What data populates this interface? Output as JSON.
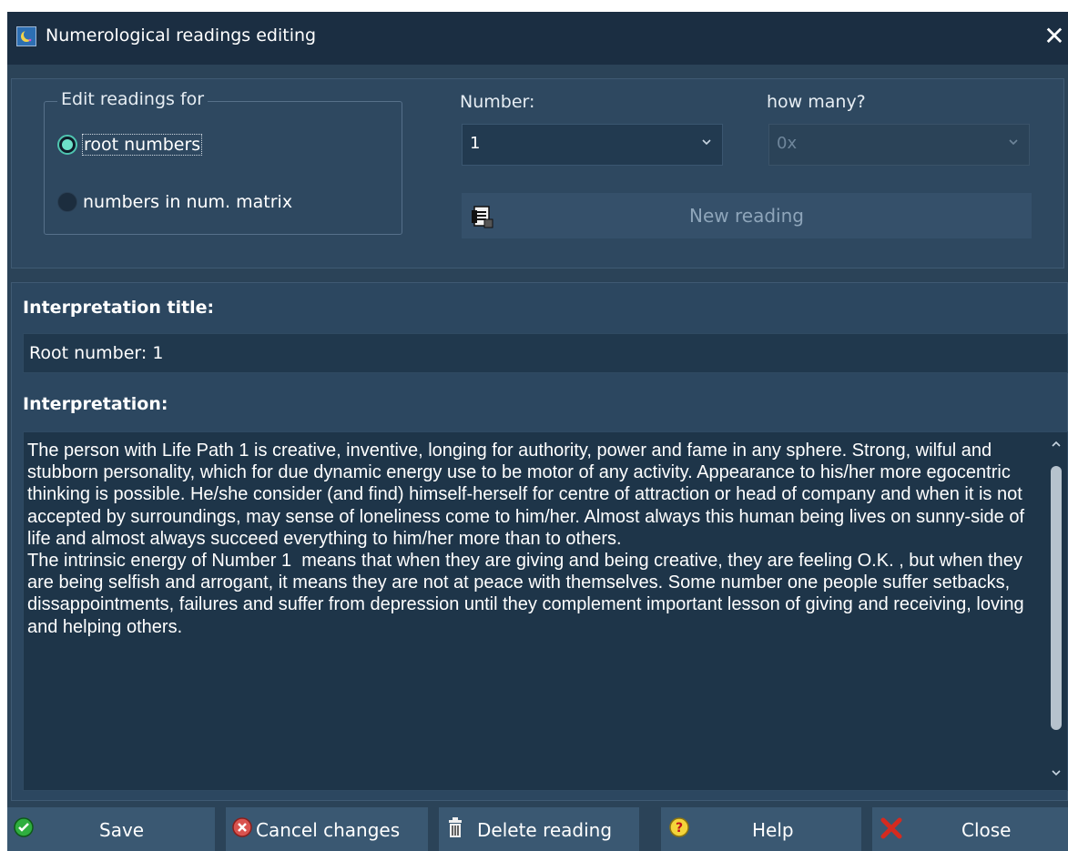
{
  "window": {
    "title": "Numerological readings editing",
    "app_icon": "moon-app-icon",
    "close_symbol": "✕"
  },
  "edit_for": {
    "legend": "Edit readings for",
    "options": [
      {
        "label": "root numbers",
        "checked": true
      },
      {
        "label": "numbers in num. matrix",
        "checked": false
      }
    ]
  },
  "number": {
    "label": "Number:",
    "value": "1"
  },
  "how_many": {
    "label": "how many?",
    "value": "0x",
    "enabled": false
  },
  "new_reading": {
    "label": "New reading",
    "icon": "new-document-icon",
    "enabled": false
  },
  "interpretation_title": {
    "label": "Interpretation title:",
    "value": "Root number: 1"
  },
  "interpretation": {
    "label": "Interpretation:",
    "text": "The person with Life Path 1 is creative, inventive, longing for authority, power and fame in any sphere. Strong, wilful and stubborn personality, which for due dynamic energy use to be motor of any activity. Appearance to his/her more egocentric thinking is possible. He/she consider (and find) himself-herself for centre of attraction or head of company and when it is not accepted by surroundings, may sense of loneliness come to him/her. Almost always this human being lives on sunny-side of life and almost always succeed everything to him/her more than to others.\nThe intrinsic energy of Number 1  means that when they are giving and being creative, they are feeling O.K. , but when they are being selfish and arrogant, it means they are not at peace with themselves. Some number one people suffer setbacks, dissappointments, failures and suffer from depression until they complement important lesson of giving and receiving, loving and helping others."
  },
  "buttons": {
    "save": "Save",
    "cancel": "Cancel changes",
    "delete": "Delete reading",
    "help": "Help",
    "close": "Close"
  },
  "colors": {
    "window_bg": "#2b4358",
    "titlebar_bg": "#1b2e42",
    "accent_radio": "#4fc5b0"
  }
}
